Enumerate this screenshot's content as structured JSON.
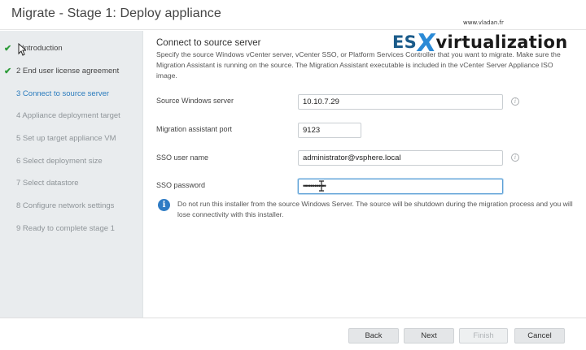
{
  "window": {
    "title": "Migrate - Stage 1: Deploy appliance"
  },
  "watermark": {
    "site": "www.vladan.fr",
    "brand_es": "ES",
    "brand_x": "X",
    "brand_rest": "virtualization"
  },
  "sidebar": {
    "steps": [
      {
        "label": "Introduction",
        "status": "done"
      },
      {
        "label": "2 End user license agreement",
        "status": "done"
      },
      {
        "label": "3 Connect to source server",
        "status": "active"
      },
      {
        "label": "4 Appliance deployment target",
        "status": "pending"
      },
      {
        "label": "5 Set up target appliance VM",
        "status": "pending"
      },
      {
        "label": "6 Select deployment size",
        "status": "pending"
      },
      {
        "label": "7 Select datastore",
        "status": "pending"
      },
      {
        "label": "8 Configure network settings",
        "status": "pending"
      },
      {
        "label": "9 Ready to complete stage 1",
        "status": "pending"
      }
    ]
  },
  "main": {
    "section_title": "Connect to source server",
    "description": "Specify the source Windows vCenter server, vCenter SSO, or Platform Services Controller that you want to migrate. Make sure the Migration Assistant is running on the source. The Migration Assistant executable is included in the vCenter Server Appliance ISO image.",
    "fields": {
      "source_server": {
        "label": "Source Windows server",
        "value": "10.10.7.29"
      },
      "assistant_port": {
        "label": "Migration assistant port",
        "value": "9123"
      },
      "sso_user": {
        "label": "SSO user name",
        "value": "administrator@vsphere.local"
      },
      "sso_password": {
        "label": "SSO password",
        "value": "••••••••••••"
      }
    },
    "note": "Do not run this installer from the source Windows Server. The source will be shutdown during the migration process and you will lose connectivity with this installer."
  },
  "footer": {
    "back": "Back",
    "next": "Next",
    "finish": "Finish",
    "cancel": "Cancel"
  },
  "colors": {
    "accent": "#2a7bbd",
    "check": "#2e9c3a",
    "sidebar_bg": "#e9ecee",
    "info_badge": "#2e7bc4"
  }
}
